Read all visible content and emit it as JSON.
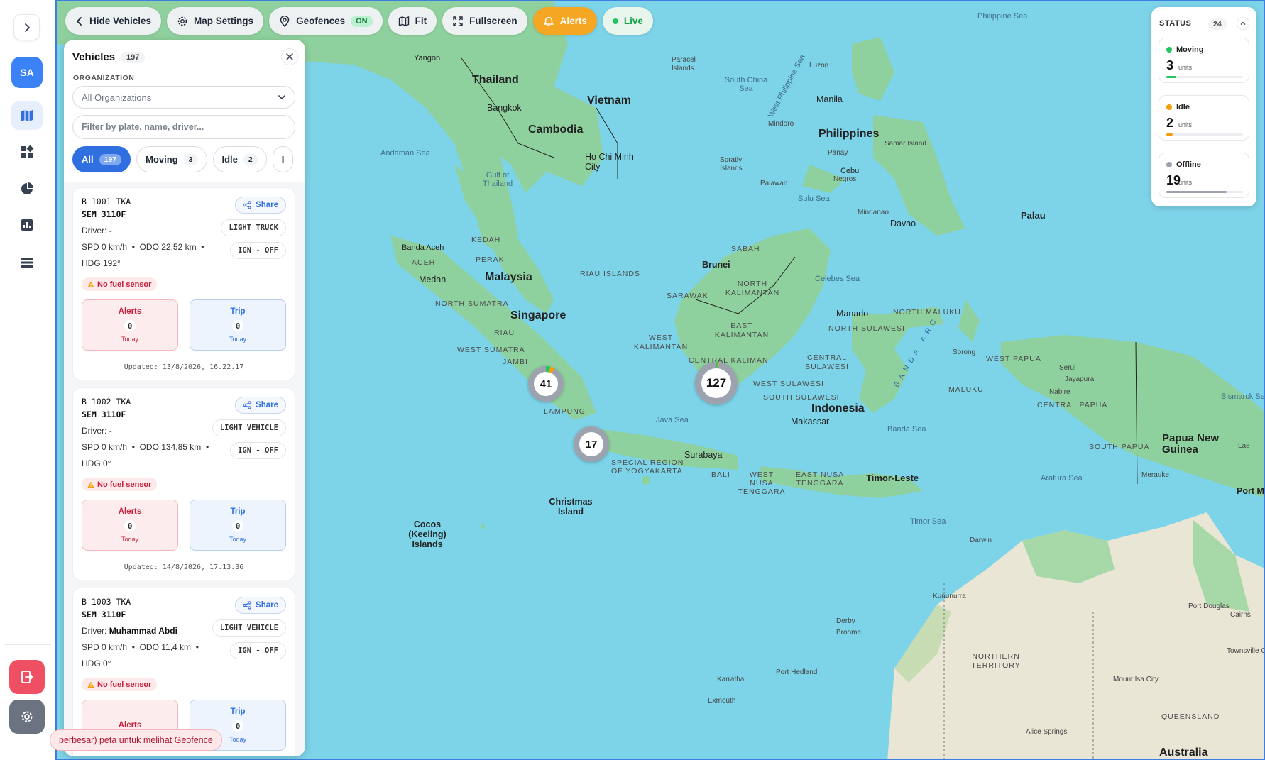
{
  "rail": {
    "avatar_initials": "SA"
  },
  "toolbar": {
    "hide_vehicles": "Hide Vehicles",
    "map_settings": "Map Settings",
    "geofences": "Geofences",
    "geofences_state": "ON",
    "fit": "Fit",
    "fullscreen": "Fullscreen",
    "alerts": "Alerts",
    "live": "Live"
  },
  "panel": {
    "title": "Vehicles",
    "count": "197",
    "org_label": "ORGANIZATION",
    "org_value": "All Organizations",
    "filter_placeholder": "Filter by plate, name, driver...",
    "chips": [
      {
        "label": "All",
        "count": "197"
      },
      {
        "label": "Moving",
        "count": "3"
      },
      {
        "label": "Idle",
        "count": "2"
      },
      {
        "label": "I",
        "count": ""
      }
    ],
    "vehicles": [
      {
        "plate": "B 1001 TKA",
        "model": "SEM 3110F",
        "driver_label": "Driver:",
        "driver": "-",
        "spd": "SPD 0 km/h",
        "odo": "ODO 22,52 km",
        "hdg": "HDG 192°",
        "type": "LIGHT TRUCK",
        "ign": "IGN - OFF",
        "fuel": "No fuel sensor",
        "alerts_label": "Alerts",
        "alerts_count": "0",
        "trip_label": "Trip",
        "trip_count": "0",
        "today": "Today",
        "share": "Share",
        "updated": "Updated: 13/8/2026, 16.22.17"
      },
      {
        "plate": "B 1002 TKA",
        "model": "SEM 3110F",
        "driver_label": "Driver:",
        "driver": "-",
        "spd": "SPD 0 km/h",
        "odo": "ODO 134,85 km",
        "hdg": "HDG 0°",
        "type": "LIGHT VEHICLE",
        "ign": "IGN - OFF",
        "fuel": "No fuel sensor",
        "alerts_label": "Alerts",
        "alerts_count": "0",
        "trip_label": "Trip",
        "trip_count": "0",
        "today": "Today",
        "share": "Share",
        "updated": "Updated: 14/8/2026, 17.13.36"
      },
      {
        "plate": "B 1003 TKA",
        "model": "SEM 3110F",
        "driver_label": "Driver:",
        "driver": "Muhammad Abdi",
        "spd": "SPD 0 km/h",
        "odo": "ODO 11,4 km",
        "hdg": "HDG 0°",
        "type": "LIGHT VEHICLE",
        "ign": "IGN - OFF",
        "fuel": "No fuel sensor",
        "alerts_label": "Alerts",
        "alerts_count": "",
        "trip_label": "Trip",
        "trip_count": "0",
        "today": "Today",
        "share": "Share",
        "updated": ""
      }
    ]
  },
  "status": {
    "title": "STATUS",
    "count": "24",
    "items": [
      {
        "name": "Moving",
        "value": "3",
        "unit": "units",
        "color": "#22c55e",
        "fraction": 0.125
      },
      {
        "name": "Idle",
        "value": "2",
        "unit": "units",
        "color": "#f59e0b",
        "fraction": 0.083
      },
      {
        "name": "Offline",
        "value": "19",
        "unit": "units",
        "color": "#9ca3af",
        "fraction": 0.79
      }
    ]
  },
  "map": {
    "clusters": [
      "41",
      "127",
      "17"
    ],
    "labels": {
      "countries": [
        "Thailand",
        "Vietnam",
        "Cambodia",
        "Philippines",
        "Malaysia",
        "Singapore",
        "Indonesia",
        "Brunei",
        "Papua New Guinea",
        "Timor-Leste",
        "Australia",
        "Palau"
      ],
      "cities": [
        "Yangon",
        "Bangkok",
        "Ho Chi Minh City",
        "Manila",
        "Cebu",
        "Davao",
        "Banda Aceh",
        "Medan",
        "Manado",
        "Makassar",
        "Surabaya",
        "Darwin",
        "Cairns",
        "Port Hedland",
        "Karratha",
        "Exmouth",
        "Broome",
        "Derby",
        "Kununurra",
        "Sorong",
        "Jayapura",
        "Lae",
        "Merauke",
        "Mount Isa City",
        "Alice Springs",
        "Townsville City",
        "Port Douglas",
        "Nabire",
        "Serui",
        "Port M"
      ],
      "seas": [
        "Philippine Sea",
        "South China Sea",
        "Andaman Sea",
        "Gulf of Thailand",
        "Sulu Sea",
        "Celebes Sea",
        "Java Sea",
        "Banda Sea",
        "Timor Sea",
        "Arafura Sea",
        "Bismarck Se",
        "West Philippine Sea"
      ],
      "regions": [
        "SABAH",
        "SARAWAK",
        "NORTH KALIMANTAN",
        "EAST KALIMANTAN",
        "WEST KALIMANTAN",
        "CENTRAL KALIMAN",
        "RIAU ISLANDS",
        "NORTH SUMATRA",
        "WEST SUMATRA",
        "RIAU",
        "JAMBI",
        "LAMPUNG",
        "ACEH",
        "KEDAH",
        "PERAK",
        "NORTH MALUKU",
        "NORTH SULAWESI",
        "CENTRAL SULAWESI",
        "WEST SULAWESI",
        "SOUTH SULAWESI",
        "MALUKU",
        "WEST PAPUA",
        "CENTRAL PAPUA",
        "SOUTH PAPUA",
        "BALI",
        "WEST NUSA TENGGARA",
        "EAST NUSA TENGGARA",
        "SPECIAL REGION OF YOGYAKARTA",
        "NORTHERN TERRITORY",
        "QUEENSLAND"
      ],
      "islands": [
        "Paracel Islands",
        "Spratly Islands",
        "Christmas Island",
        "Cocos (Keeling) Islands",
        "Luzon",
        "Mindoro",
        "Palawan",
        "Panay",
        "Negros",
        "Samar Island",
        "Mindanao",
        "BANDA ARC"
      ]
    }
  },
  "toast": "perbesar) peta untuk melihat Geofence"
}
